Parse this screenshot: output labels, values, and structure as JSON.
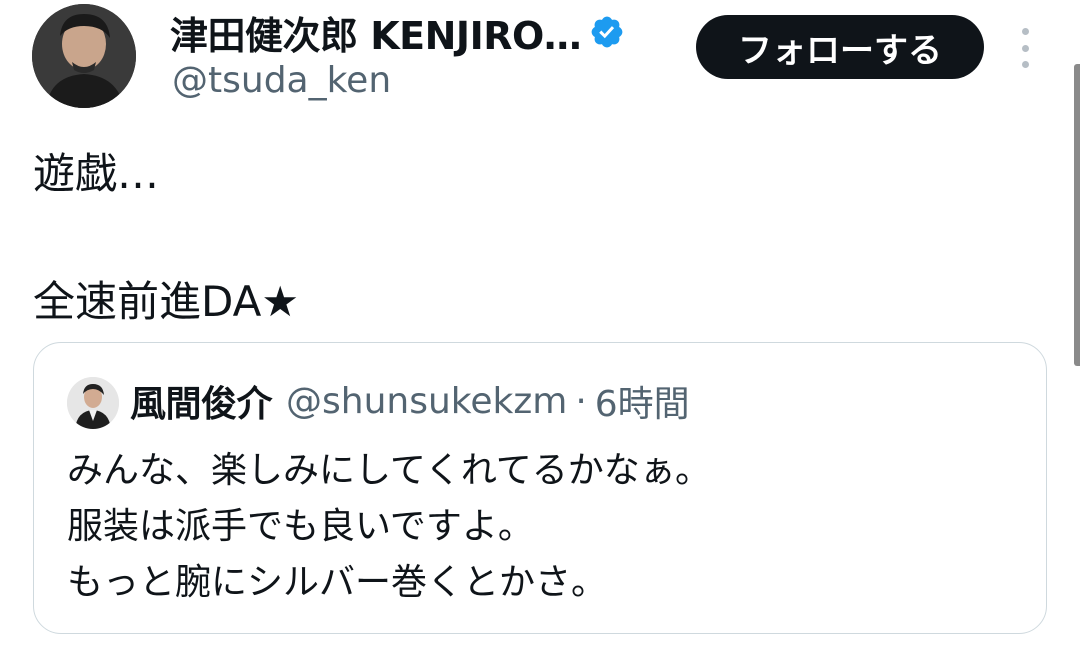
{
  "author": {
    "display_name": "津田健次郎 KENJIRO…",
    "handle": "@tsuda_ken",
    "verified_icon": "verified-badge-icon",
    "avatar_icon": "profile-photo"
  },
  "actions": {
    "follow_label": "フォローする",
    "more_icon": "more-vertical-icon"
  },
  "tweet": {
    "lines": [
      "遊戯…",
      "全速前進DA★"
    ]
  },
  "quoted_tweet": {
    "display_name": "風間俊介",
    "handle": "@shunsukekzm",
    "separator": "·",
    "time": "6時間",
    "lines": [
      "みんな、楽しみにしてくれてるかなぁ。",
      "服装は派手でも良いですよ。",
      "もっと腕にシルバー巻くとかさ。"
    ]
  },
  "colors": {
    "text_primary": "#0f1419",
    "text_secondary": "#536471",
    "verified_blue": "#1d9bf0",
    "button_bg": "#0f1419",
    "border": "#cfd9de"
  }
}
